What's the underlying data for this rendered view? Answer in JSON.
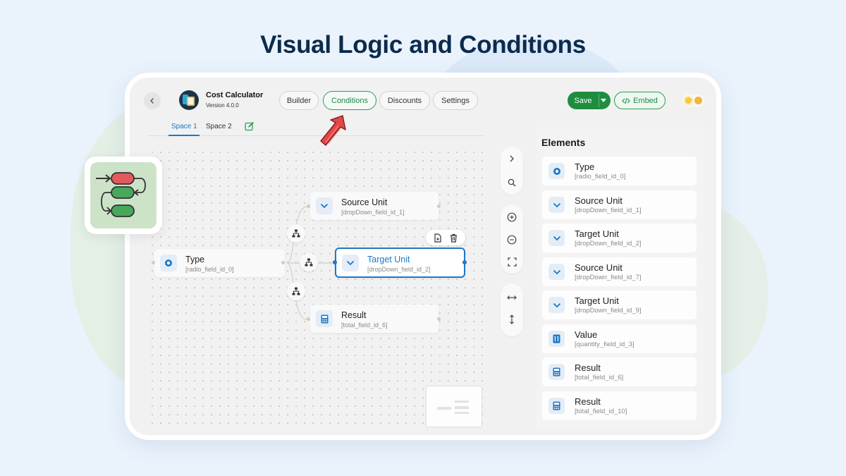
{
  "headline": "Visual Logic and Conditions",
  "app": {
    "title": "Cost Calculator",
    "version": "Version 4.0.0",
    "back_icon": "chevron-left-icon",
    "logo_icon": "calculator-logo-icon"
  },
  "nav": {
    "tabs": [
      {
        "label": "Builder",
        "active": false
      },
      {
        "label": "Conditions",
        "active": true
      },
      {
        "label": "Discounts",
        "active": false
      },
      {
        "label": "Settings",
        "active": false
      }
    ],
    "save_label": "Save",
    "embed_label": "Embed",
    "embed_icon": "code-icon",
    "theme_icon": "sun-moon-toggle-icon"
  },
  "spaces": {
    "tabs": [
      {
        "label": "Space 1",
        "active": true
      },
      {
        "label": "Space 2",
        "active": false
      }
    ],
    "edit_icon": "edit-icon"
  },
  "canvas": {
    "nodes": [
      {
        "name": "Type",
        "field_id": "[radio_field_id_0]",
        "icon": "radio-icon",
        "selected": false
      },
      {
        "name": "Source Unit",
        "field_id": "[dropDown_field_id_1]",
        "icon": "chevron-down-icon",
        "selected": false
      },
      {
        "name": "Target Unit",
        "field_id": "[dropDown_field_id_2]",
        "icon": "chevron-down-icon",
        "selected": true
      },
      {
        "name": "Result",
        "field_id": "[total_field_id_6]",
        "icon": "calculator-icon",
        "selected": false
      }
    ],
    "node_tools": [
      "duplicate-icon",
      "trash-icon"
    ],
    "condition_icon": "condition-branch-icon"
  },
  "controls": {
    "top": [
      "chevron-right-icon",
      "search-icon"
    ],
    "zoom": [
      "zoom-in-icon",
      "zoom-out-icon",
      "fit-screen-icon"
    ],
    "layout": [
      "horizontal-arrows-icon",
      "vertical-arrows-icon"
    ]
  },
  "elements": {
    "title": "Elements",
    "items": [
      {
        "name": "Type",
        "field_id": "[radio_field_id_0]",
        "icon": "radio-icon"
      },
      {
        "name": "Source Unit",
        "field_id": "[dropDown_field_id_1]",
        "icon": "chevron-down-icon"
      },
      {
        "name": "Target Unit",
        "field_id": "[dropDown_field_id_2]",
        "icon": "chevron-down-icon"
      },
      {
        "name": "Source Unit",
        "field_id": "[dropDown_field_id_7]",
        "icon": "chevron-down-icon"
      },
      {
        "name": "Target Unit",
        "field_id": "[dropDown_field_id_9]",
        "icon": "chevron-down-icon"
      },
      {
        "name": "Value",
        "field_id": "[quantity_field_id_3]",
        "icon": "quantity-icon"
      },
      {
        "name": "Result",
        "field_id": "[total_field_id_6]",
        "icon": "calculator-icon"
      },
      {
        "name": "Result",
        "field_id": "[total_field_id_10]",
        "icon": "calculator-icon"
      }
    ]
  },
  "colors": {
    "accent_blue": "#1d78c8",
    "accent_green": "#1e8d3f",
    "headline": "#0c2b4d",
    "pointer_arrow": "#d63a3a"
  }
}
